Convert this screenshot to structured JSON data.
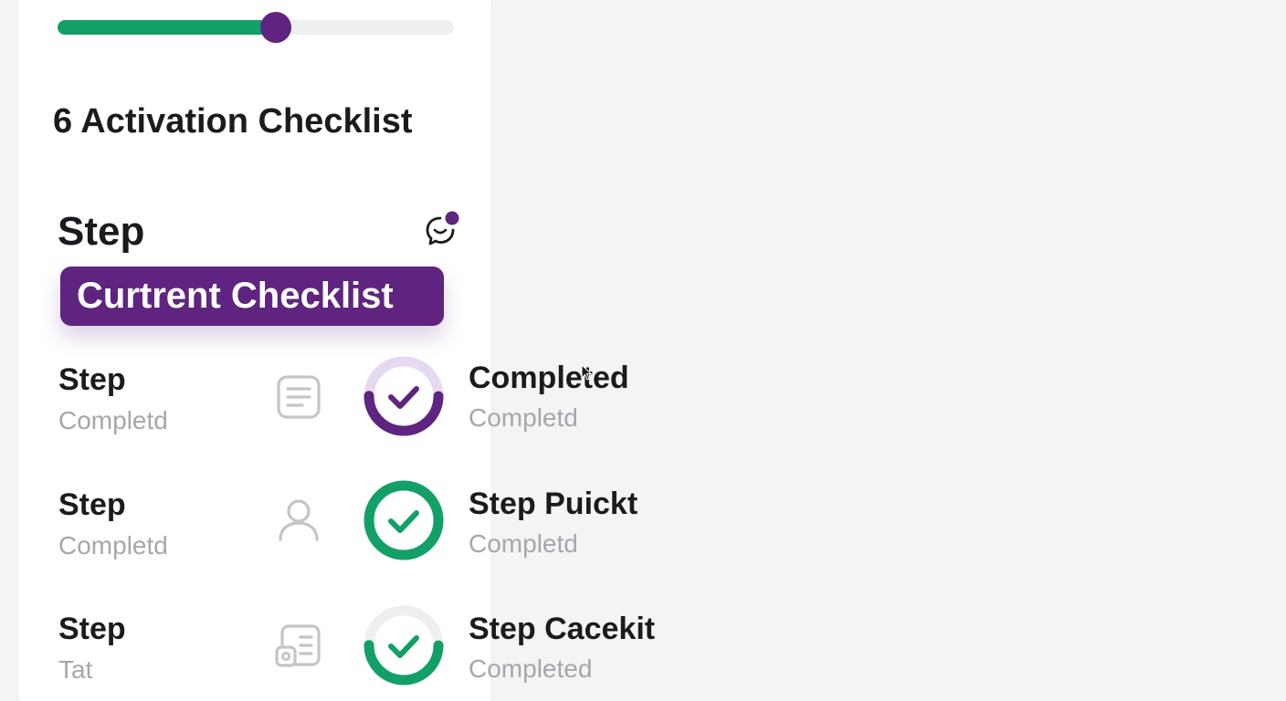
{
  "progress": {
    "value": 0.55
  },
  "title": "6 Activation Checklist",
  "section": {
    "heading": "Step",
    "current_badge": "Curtrent Checklist"
  },
  "colors": {
    "purple": "#5f247f",
    "green": "#12a068",
    "light_purple": "#e6d9ef",
    "light_gray": "#efeff1"
  },
  "left_steps": [
    {
      "title": "Step",
      "subtitle": "Completd",
      "icon": "document-lines-icon"
    },
    {
      "title": "Step",
      "subtitle": "Completd",
      "icon": "user-icon"
    },
    {
      "title": "Step",
      "subtitle": "Tat",
      "icon": "id-card-icon"
    }
  ],
  "right_steps": [
    {
      "title": "Completed",
      "subtitle": "Completd",
      "status": "in-progress",
      "ring_color": "purple",
      "ring_progress": 0.5
    },
    {
      "title": "Step Puickt",
      "subtitle": "Completd",
      "status": "completed",
      "ring_color": "green",
      "ring_progress": 1.0
    },
    {
      "title": "Step Cacekit",
      "subtitle": "Completed",
      "status": "partial",
      "ring_color": "green",
      "ring_progress": 0.5
    }
  ]
}
